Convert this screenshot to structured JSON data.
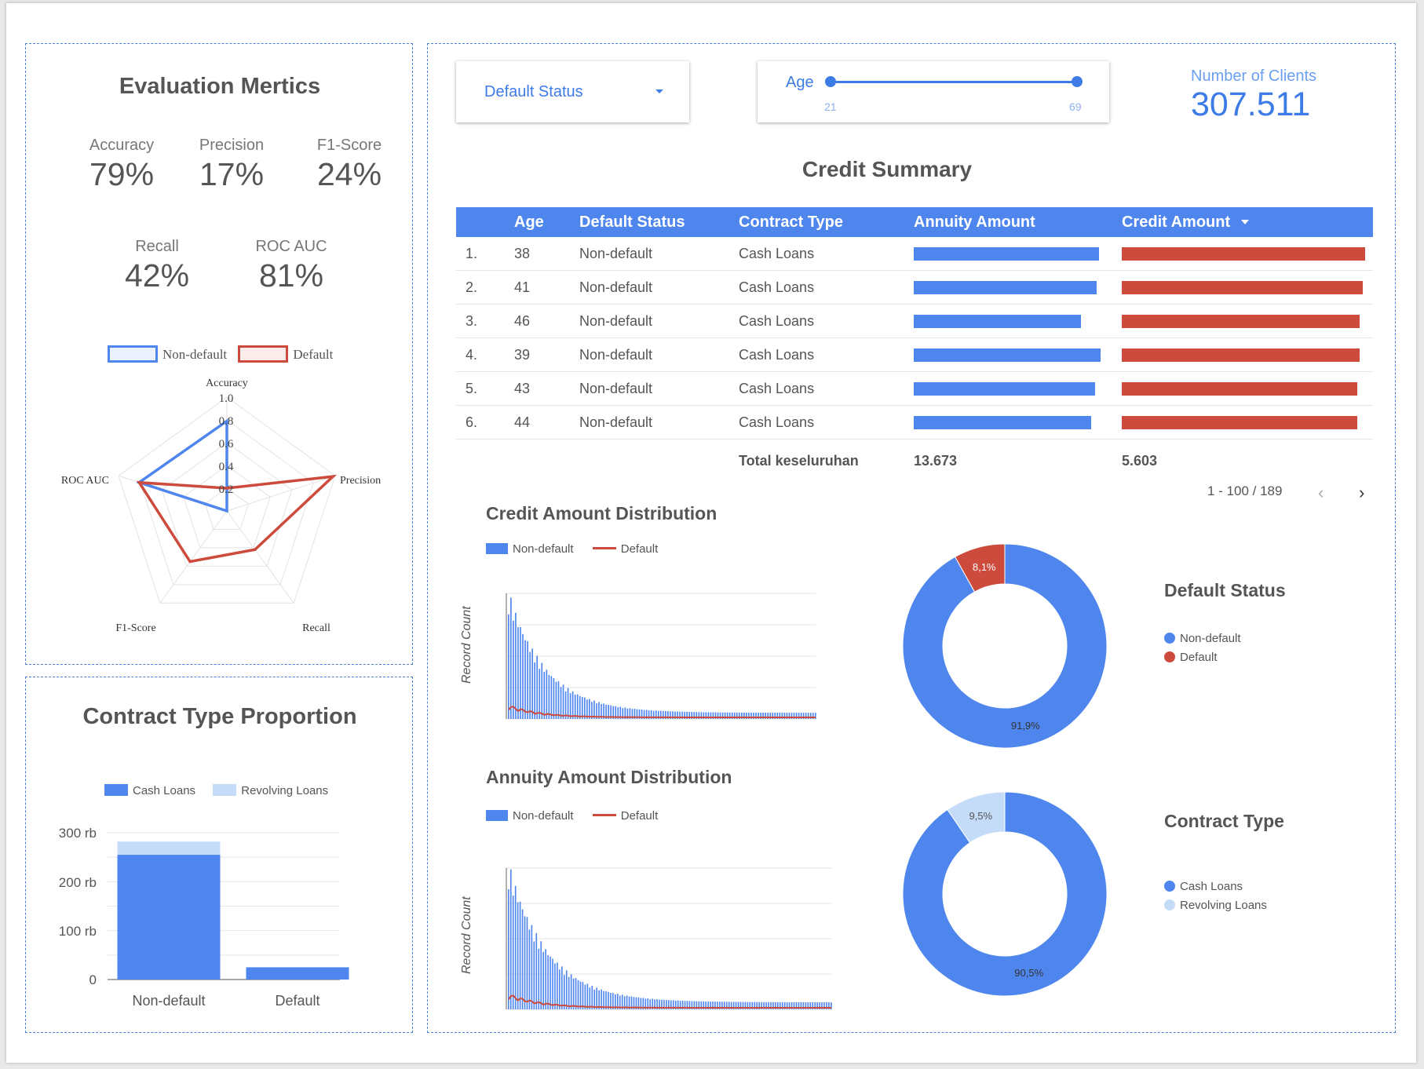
{
  "metrics_panel": {
    "title": "Evaluation Mertics",
    "items": [
      {
        "label": "Accuracy",
        "value": "79%"
      },
      {
        "label": "Precision",
        "value": "17%"
      },
      {
        "label": "F1-Score",
        "value": "24%"
      },
      {
        "label": "Recall",
        "value": "42%"
      },
      {
        "label": "ROC AUC",
        "value": "81%"
      }
    ]
  },
  "radar": {
    "legend": [
      "Non-default",
      "Default"
    ],
    "axes": [
      "Accuracy",
      "Precision",
      "Recall",
      "F1-Score",
      "ROC AUC"
    ],
    "ticks": [
      "1.0",
      "0.8",
      "0.6",
      "0.4",
      "0.2"
    ]
  },
  "contract_panel": {
    "title": "Contract Type Proportion",
    "legend": [
      "Cash Loans",
      "Revolving Loans"
    ],
    "yticks": [
      "300 rb",
      "200 rb",
      "100 rb",
      "0"
    ],
    "categories": [
      "Non-default",
      "Default"
    ]
  },
  "filters": {
    "status_label": "Default Status",
    "age_label": "Age",
    "age_min": "21",
    "age_max": "69"
  },
  "clients": {
    "label": "Number of Clients",
    "value": "307.511"
  },
  "summary": {
    "title": "Credit Summary",
    "columns": [
      "Age",
      "Default Status",
      "Contract Type",
      "Annuity Amount",
      "Credit Amount"
    ],
    "rows": [
      {
        "n": "1.",
        "age": "38",
        "status": "Non-default",
        "type": "Cash Loans"
      },
      {
        "n": "2.",
        "age": "41",
        "status": "Non-default",
        "type": "Cash Loans"
      },
      {
        "n": "3.",
        "age": "46",
        "status": "Non-default",
        "type": "Cash Loans"
      },
      {
        "n": "4.",
        "age": "39",
        "status": "Non-default",
        "type": "Cash Loans"
      },
      {
        "n": "5.",
        "age": "43",
        "status": "Non-default",
        "type": "Cash Loans"
      },
      {
        "n": "6.",
        "age": "44",
        "status": "Non-default",
        "type": "Cash Loans"
      }
    ],
    "annuity_fraction": [
      0.95,
      0.94,
      0.86,
      0.96,
      0.93,
      0.91
    ],
    "credit_fraction": [
      0.98,
      0.97,
      0.96,
      0.96,
      0.95,
      0.95
    ],
    "total_label": "Total keseluruhan",
    "total_annuity": "13.673",
    "total_credit": "5.603",
    "pagination": "1 - 100 / 189"
  },
  "dist_charts": {
    "credit_title": "Credit Amount Distribution",
    "annuity_title": "Annuity Amount Distribution",
    "legend_nd": "Non-default",
    "legend_d": "Default",
    "ylabel": "Record Count"
  },
  "donuts": {
    "status_title": "Default Status",
    "status_legend": [
      "Non-default",
      "Default"
    ],
    "type_title": "Contract Type",
    "type_legend": [
      "Cash Loans",
      "Revolving Loans"
    ]
  },
  "colors": {
    "blue": "#4f86ee",
    "red": "#cc4b3c",
    "lightblue": "#c4dcf8"
  },
  "chart_data": [
    {
      "type": "radar",
      "axes": [
        "Accuracy",
        "Precision",
        "Recall",
        "F1-Score",
        "ROC AUC"
      ],
      "ticks": [
        "1.0",
        "0.8",
        "0.6",
        "0.4",
        "0.2"
      ],
      "series": [
        {
          "name": "Non-default",
          "values": [
            0.79,
            0.0,
            0.0,
            0.0,
            0.81
          ]
        },
        {
          "name": "Default",
          "values": [
            0.2,
            0.98,
            0.42,
            0.55,
            0.81
          ]
        }
      ]
    },
    {
      "type": "bar",
      "categories": [
        "Non-default",
        "Default"
      ],
      "series": [
        {
          "name": "Cash Loans",
          "values": [
            255000,
            25000
          ]
        },
        {
          "name": "Revolving Loans",
          "values": [
            27000,
            0
          ]
        }
      ],
      "ylim": [
        0,
        300000
      ]
    },
    {
      "type": "pie",
      "title": "Default Status",
      "labels": [
        "Non-default",
        "Default"
      ],
      "values": [
        91.9,
        8.1
      ],
      "value_labels": [
        "91,9%",
        "8,1%"
      ]
    },
    {
      "type": "pie",
      "title": "Contract Type",
      "labels": [
        "Cash Loans",
        "Revolving Loans"
      ],
      "values": [
        90.5,
        9.5
      ],
      "value_labels": [
        "90,5%",
        "9,5%"
      ]
    }
  ]
}
